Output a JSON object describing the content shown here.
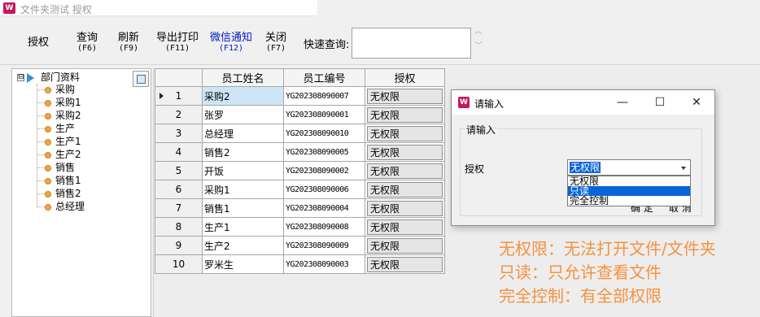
{
  "window": {
    "title": "文件夹测试 授权",
    "icon_text": "W"
  },
  "toolbar": {
    "buttons": [
      {
        "label": "授权",
        "key": ""
      },
      {
        "label": "查询",
        "key": "(F6)"
      },
      {
        "label": "刷新",
        "key": "(F9)"
      },
      {
        "label": "导出打印",
        "key": "(F11)"
      },
      {
        "label": "微信通知",
        "key": "(F12)"
      },
      {
        "label": "关闭",
        "key": "(F7)"
      }
    ],
    "quick_search_label": "快速查询:",
    "quick_search_value": ""
  },
  "tree": {
    "root_toggle": "⊟",
    "root_label": "部门资料",
    "items": [
      "采购",
      "采购1",
      "采购2",
      "生产",
      "生产1",
      "生产2",
      "销售",
      "销售1",
      "销售2",
      "总经理"
    ]
  },
  "grid": {
    "columns": [
      "",
      "员工姓名",
      "员工编号",
      "授权"
    ],
    "rows": [
      {
        "no": "1",
        "name": "采购2",
        "code": "YG202308090007",
        "perm": "无权限"
      },
      {
        "no": "2",
        "name": "张罗",
        "code": "YG202308090001",
        "perm": "无权限"
      },
      {
        "no": "3",
        "name": "总经理",
        "code": "YG202308090010",
        "perm": "无权限"
      },
      {
        "no": "4",
        "name": "销售2",
        "code": "YG202308090005",
        "perm": "无权限"
      },
      {
        "no": "5",
        "name": "开饭",
        "code": "YG202308090002",
        "perm": "无权限"
      },
      {
        "no": "6",
        "name": "采购1",
        "code": "YG202308090006",
        "perm": "无权限"
      },
      {
        "no": "7",
        "name": "销售1",
        "code": "YG202308090004",
        "perm": "无权限"
      },
      {
        "no": "8",
        "name": "生产1",
        "code": "YG202308090008",
        "perm": "无权限"
      },
      {
        "no": "9",
        "name": "生产2",
        "code": "YG202308090009",
        "perm": "无权限"
      },
      {
        "no": "10",
        "name": "罗米生",
        "code": "YG202308090003",
        "perm": "无权限"
      }
    ]
  },
  "dialog": {
    "title": "请输入",
    "group_label": "请输入",
    "field_label": "授权",
    "selected_value": "无权限",
    "options": [
      "无权限",
      "只读",
      "完全控制"
    ],
    "highlighted_option": "只读",
    "ok_label": "确 定",
    "cancel_label": "取 消"
  },
  "annotations": [
    "无权限：无法打开文件/文件夹",
    "只读：只允许查看文件",
    "完全控制：有全部权限"
  ],
  "colors": {
    "accent_blue": "#0018c8",
    "note_orange": "#f5923e",
    "selection": "#0a64d6"
  }
}
